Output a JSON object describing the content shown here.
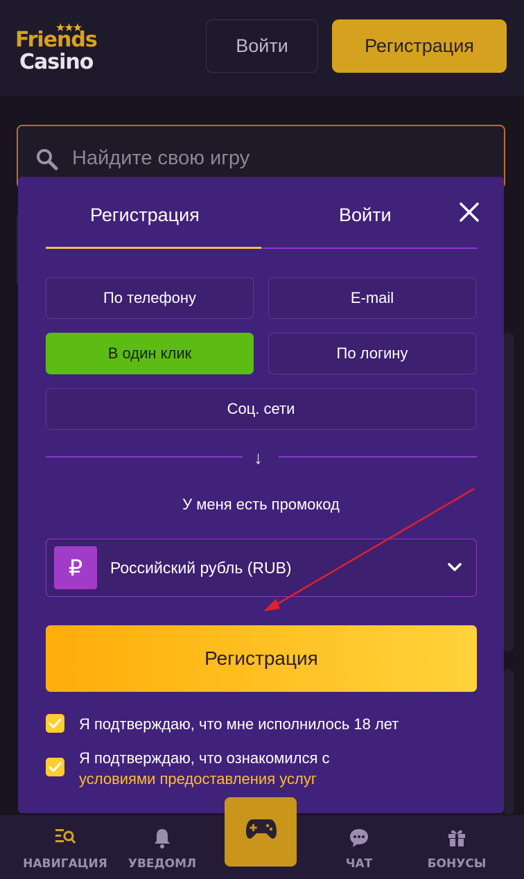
{
  "header": {
    "logo_top": "Friends",
    "logo_bottom": "Casino",
    "logo_stars": "★★★",
    "login_label": "Войти",
    "register_label": "Регистрация"
  },
  "search": {
    "placeholder": "Найдите свою игру"
  },
  "modal": {
    "tabs": [
      {
        "label": "Регистрация",
        "active": true
      },
      {
        "label": "Войти",
        "active": false
      }
    ],
    "options": [
      {
        "label": "По телефону",
        "active": false
      },
      {
        "label": "E-mail",
        "active": false
      },
      {
        "label": "В один клик",
        "active": true
      },
      {
        "label": "По логину",
        "active": false
      },
      {
        "label": "Соц. сети",
        "active": false
      }
    ],
    "divider_arrow": "↓",
    "promo_label": "У меня есть промокод",
    "currency": {
      "symbol": "₽",
      "label": "Российский рубль (RUB)"
    },
    "register_button": "Регистрация",
    "checkboxes": [
      {
        "checked": true,
        "text": "Я подтверждаю, что мне исполнилось 18 лет"
      },
      {
        "checked": true,
        "text": "Я подтверждаю, что ознакомился с",
        "link": "условиями предоставления услуг"
      }
    ]
  },
  "bottom_nav": [
    {
      "label": "НАВИГАЦИЯ",
      "icon": "navigation-icon"
    },
    {
      "label": "УВЕДОМЛ",
      "icon": "bell-icon"
    },
    {
      "label": "",
      "icon": "gamepad-icon"
    },
    {
      "label": "ЧАТ",
      "icon": "chat-icon"
    },
    {
      "label": "БОНУСЫ",
      "icon": "gift-icon"
    }
  ],
  "colors": {
    "accent_gold": "#d4a21e",
    "modal_bg": "#41227a",
    "active_option": "#5cbc14",
    "cta_gradient_start": "#ffad0a",
    "cta_gradient_end": "#ffd33a",
    "link": "#ffbf2a",
    "annotation_arrow": "#e0202a"
  }
}
